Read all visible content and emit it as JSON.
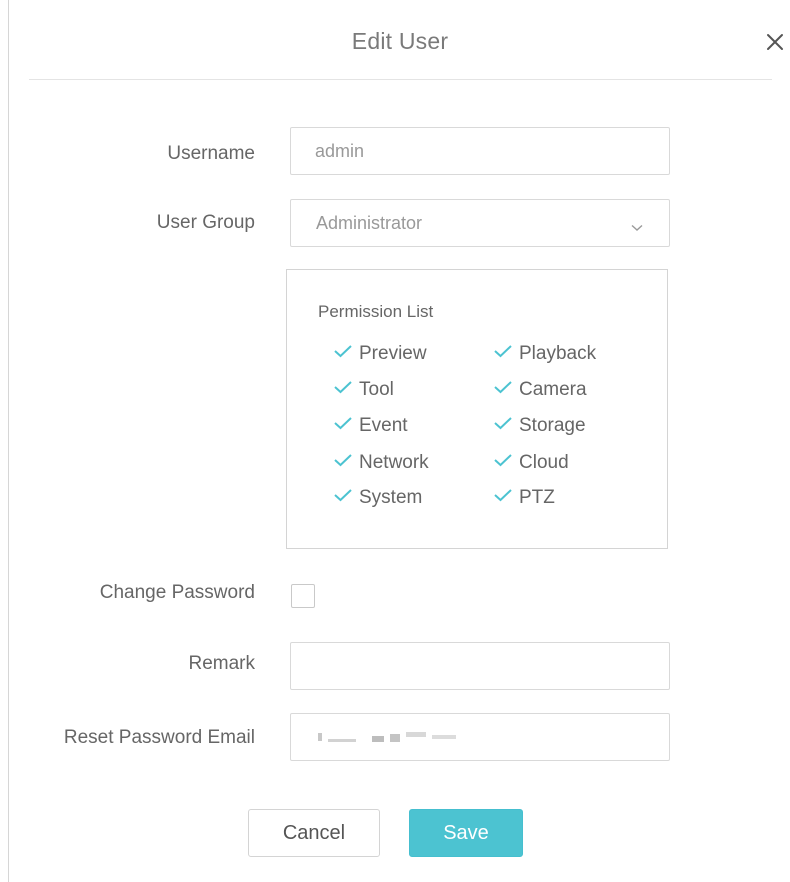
{
  "dialog": {
    "title": "Edit User",
    "close_icon": "close-icon"
  },
  "form": {
    "username": {
      "label": "Username",
      "value": "admin"
    },
    "user_group": {
      "label": "User Group",
      "value": "Administrator",
      "icon": "chevron-down-icon"
    },
    "permission_list": {
      "title": "Permission List",
      "check_color": "#4cc3d1",
      "items": [
        "Preview",
        "Playback",
        "Tool",
        "Camera",
        "Event",
        "Storage",
        "Network",
        "Cloud",
        "System",
        "PTZ"
      ]
    },
    "change_password": {
      "label": "Change Password",
      "checked": false
    },
    "remark": {
      "label": "Remark",
      "value": ""
    },
    "reset_email": {
      "label": "Reset Password Email"
    }
  },
  "buttons": {
    "cancel": "Cancel",
    "save": "Save",
    "save_color": "#4cc3d1"
  }
}
